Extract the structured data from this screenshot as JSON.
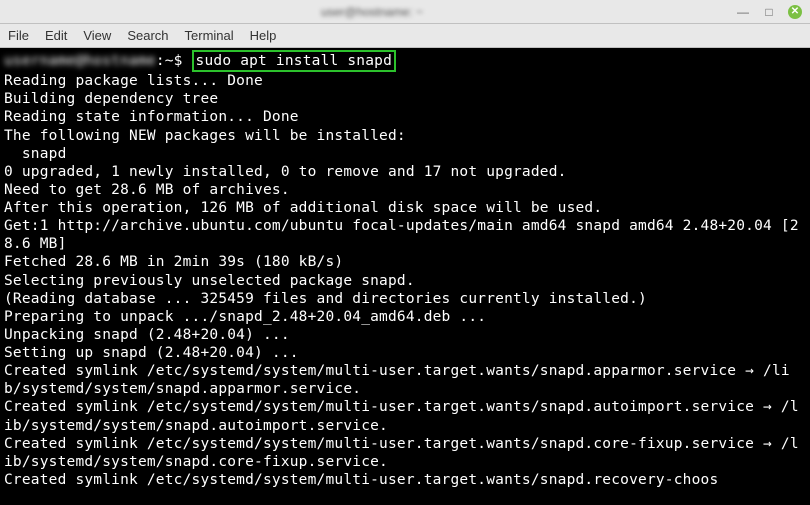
{
  "titlebar": {
    "title": "user@hostname: ~"
  },
  "window_controls": {
    "minimize": "—",
    "maximize": "□",
    "close": "✕"
  },
  "menubar": {
    "file": "File",
    "edit": "Edit",
    "view": "View",
    "search": "Search",
    "terminal": "Terminal",
    "help": "Help"
  },
  "prompt": {
    "userhost": "username@hostname",
    "path": ":~$",
    "command": "sudo apt install snapd"
  },
  "output": [
    "Reading package lists... Done",
    "Building dependency tree       ",
    "Reading state information... Done",
    "The following NEW packages will be installed:",
    "  snapd",
    "0 upgraded, 1 newly installed, 0 to remove and 17 not upgraded.",
    "Need to get 28.6 MB of archives.",
    "After this operation, 126 MB of additional disk space will be used.",
    "Get:1 http://archive.ubuntu.com/ubuntu focal-updates/main amd64 snapd amd64 2.48+20.04 [28.6 MB]",
    "Fetched 28.6 MB in 2min 39s (180 kB/s)                                         ",
    "Selecting previously unselected package snapd.",
    "(Reading database ... 325459 files and directories currently installed.)",
    "Preparing to unpack .../snapd_2.48+20.04_amd64.deb ...",
    "Unpacking snapd (2.48+20.04) ...",
    "Setting up snapd (2.48+20.04) ...",
    "Created symlink /etc/systemd/system/multi-user.target.wants/snapd.apparmor.service → /lib/systemd/system/snapd.apparmor.service.",
    "Created symlink /etc/systemd/system/multi-user.target.wants/snapd.autoimport.service → /lib/systemd/system/snapd.autoimport.service.",
    "Created symlink /etc/systemd/system/multi-user.target.wants/snapd.core-fixup.service → /lib/systemd/system/snapd.core-fixup.service.",
    "Created symlink /etc/systemd/system/multi-user.target.wants/snapd.recovery-choos"
  ]
}
